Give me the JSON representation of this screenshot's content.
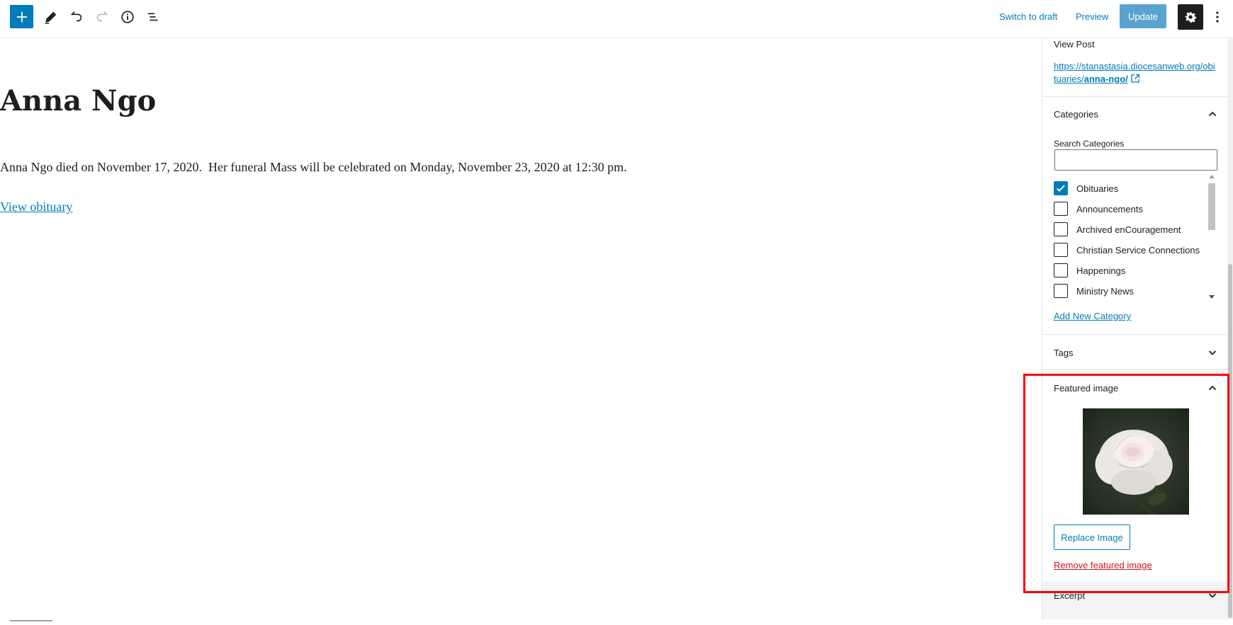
{
  "toolbar": {
    "inserter_icon": "plus-icon",
    "tools_icon": "pencil-icon",
    "undo_icon": "undo-icon",
    "redo_icon": "redo-icon",
    "info_icon": "info-icon",
    "outline_icon": "list-view-icon",
    "switch_to_draft": "Switch to draft",
    "preview": "Preview",
    "update": "Update",
    "settings_icon": "gear-icon",
    "more_icon": "more-vertical-icon",
    "accent_color": "#007cba"
  },
  "post": {
    "title": "Anna Ngo",
    "paragraph": "Anna Ngo died on November 17, 2020.  Her funeral Mass will be celebrated on Monday, November 23, 2020 at 12:30 pm.",
    "link_text": "View obituary"
  },
  "sidebar": {
    "view_post_label": "View Post",
    "permalink_prefix": "https://stanastasia.diocesanweb.org/obituaries/",
    "permalink_slug": "anna-ngo/",
    "categories": {
      "title": "Categories",
      "search_label": "Search Categories",
      "search_value": "",
      "items": [
        {
          "label": "Obituaries",
          "checked": true
        },
        {
          "label": "Announcements",
          "checked": false
        },
        {
          "label": "Archived enCouragement",
          "checked": false
        },
        {
          "label": "Christian Service Connections",
          "checked": false
        },
        {
          "label": "Happenings",
          "checked": false
        },
        {
          "label": "Ministry News",
          "checked": false
        }
      ],
      "add_new": "Add New Category"
    },
    "tags": {
      "title": "Tags"
    },
    "featured_image": {
      "title": "Featured image",
      "image_subject": "white rose",
      "replace_label": "Replace Image",
      "remove_label": "Remove featured image"
    },
    "excerpt": {
      "title": "Excerpt"
    }
  }
}
